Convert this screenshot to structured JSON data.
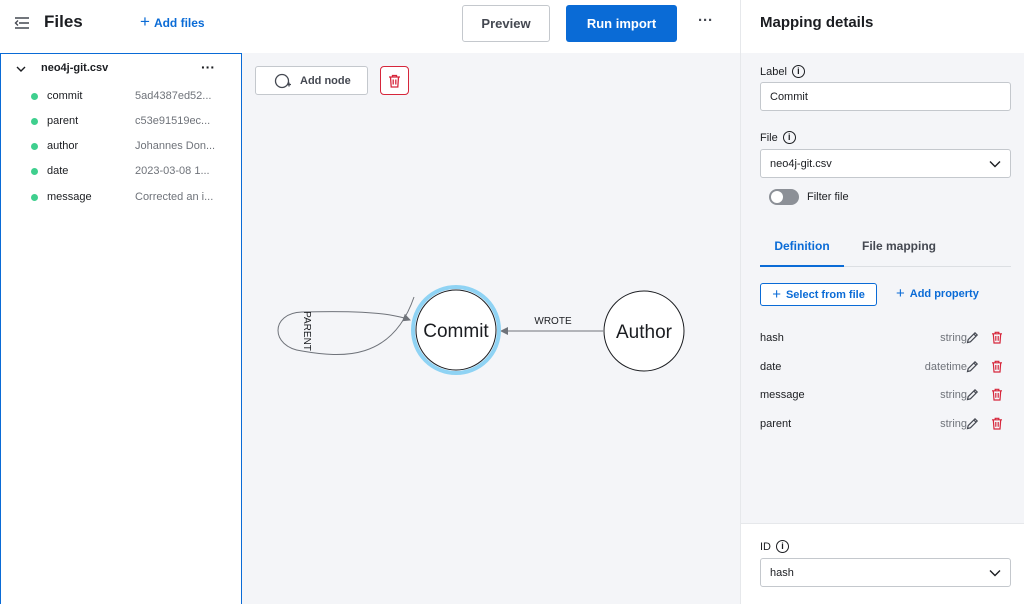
{
  "sidebar": {
    "title": "Files",
    "add_files_label": "Add files",
    "file": {
      "name": "neo4j-git.csv",
      "more": "···",
      "columns": [
        {
          "name": "commit",
          "value": "5ad4387ed52..."
        },
        {
          "name": "parent",
          "value": "c53e91519ec..."
        },
        {
          "name": "author",
          "value": "Johannes Don..."
        },
        {
          "name": "date",
          "value": "2023-03-08 1..."
        },
        {
          "name": "message",
          "value": "Corrected an i..."
        }
      ]
    }
  },
  "toolbar": {
    "preview_label": "Preview",
    "run_import_label": "Run import",
    "more": "···",
    "add_node_label": "Add node"
  },
  "graph": {
    "nodes": [
      {
        "id": "commit",
        "label": "Commit",
        "selected": true
      },
      {
        "id": "author",
        "label": "Author",
        "selected": false
      }
    ],
    "relationships": [
      {
        "label": "WROTE",
        "from": "author",
        "to": "commit"
      },
      {
        "label": "PARENT",
        "from": "commit",
        "to": "commit"
      }
    ]
  },
  "mapping": {
    "title": "Mapping details",
    "label_field": {
      "label": "Label",
      "value": "Commit"
    },
    "file_field": {
      "label": "File",
      "value": "neo4j-git.csv"
    },
    "filter_file_label": "Filter file",
    "filter_file_on": false,
    "tabs": [
      {
        "label": "Definition",
        "active": true
      },
      {
        "label": "File mapping",
        "active": false
      }
    ],
    "select_from_file_label": "Select from file",
    "add_property_label": "Add property",
    "properties": [
      {
        "name": "hash",
        "type": "string"
      },
      {
        "name": "date",
        "type": "datetime"
      },
      {
        "name": "message",
        "type": "string"
      },
      {
        "name": "parent",
        "type": "string"
      }
    ],
    "id_field": {
      "label": "ID",
      "value": "hash"
    }
  },
  "colors": {
    "primary": "#0a6bd6",
    "danger": "#d6263b",
    "column_dot": "#3fcf8e",
    "node_selected_ring": "#8fd3f4"
  }
}
